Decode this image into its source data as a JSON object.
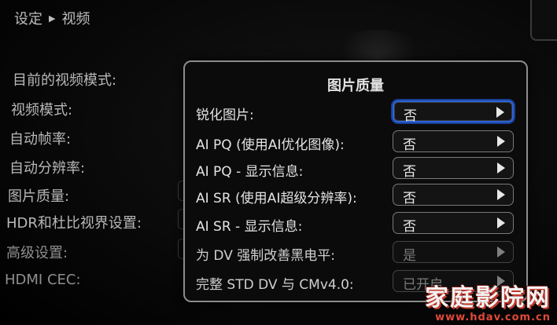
{
  "breadcrumb": {
    "parent": "设定",
    "current": "视频"
  },
  "left_menu": {
    "items": [
      {
        "label": "目前的视频模式:"
      },
      {
        "label": "视频模式:"
      },
      {
        "label": "自动帧率:"
      },
      {
        "label": "自动分辨率:"
      },
      {
        "label": "图片质量:"
      },
      {
        "label": "HDR和杜比视界设置:"
      },
      {
        "label": "高级设置:"
      },
      {
        "label": "HDMI CEC:"
      }
    ]
  },
  "dialog": {
    "title": "图片质量",
    "rows": [
      {
        "label": "锐化图片:",
        "value": "否",
        "focused": true,
        "disabled": false
      },
      {
        "label": "AI PQ (使用AI优化图像):",
        "value": "否",
        "focused": false,
        "disabled": false
      },
      {
        "label": "AI PQ - 显示信息:",
        "value": "否",
        "focused": false,
        "disabled": false
      },
      {
        "label": "AI SR (使用AI超级分辨率):",
        "value": "否",
        "focused": false,
        "disabled": false
      },
      {
        "label": "AI SR - 显示信息:",
        "value": "否",
        "focused": false,
        "disabled": false
      },
      {
        "label": "为 DV 强制改善黑电平:",
        "value": "是",
        "focused": false,
        "disabled": true
      },
      {
        "label": "完整 STD DV 与 CMv4.0:",
        "value": "已开启",
        "focused": false,
        "disabled": true
      }
    ]
  },
  "watermark": {
    "title": "家庭影院网",
    "url": "www.hdav.com.cn"
  },
  "colors": {
    "focus": "#2b63d9",
    "dialog_border": "#8c8c8c",
    "watermark_accent": "#c0392b"
  }
}
